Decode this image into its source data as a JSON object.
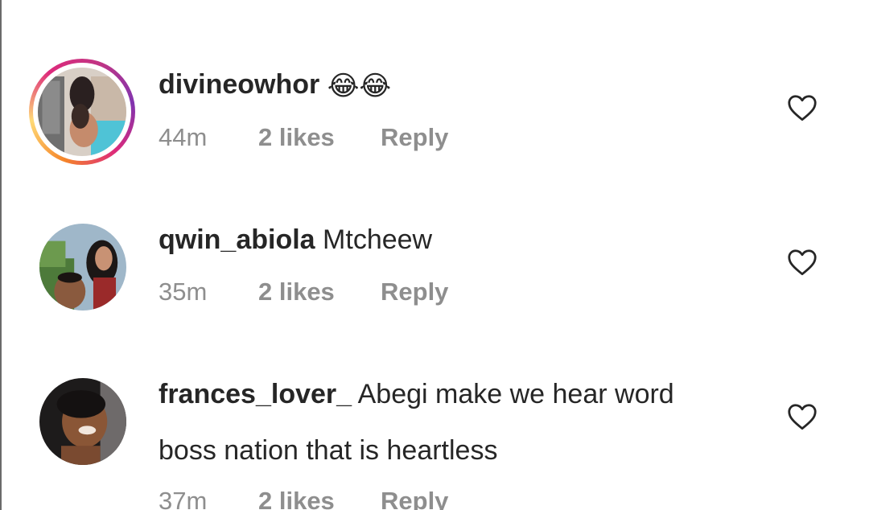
{
  "comments": [
    {
      "username": "divineowhor",
      "text": "😂😂",
      "continuation": "",
      "time": "44m",
      "likes": "2 likes",
      "reply": "Reply",
      "story_ring": true,
      "icon": "heart-outline-icon"
    },
    {
      "username": "qwin_abiola",
      "text": "Mtcheew",
      "continuation": "",
      "time": "35m",
      "likes": "2 likes",
      "reply": "Reply",
      "story_ring": false,
      "icon": "heart-outline-icon"
    },
    {
      "username": "frances_lover_",
      "text": "Abegi make we hear word",
      "continuation": "boss nation that is heartless",
      "time": "37m",
      "likes": "2 likes",
      "reply": "Reply",
      "story_ring": false,
      "icon": "heart-outline-icon"
    }
  ],
  "colors": {
    "text_primary": "#262626",
    "text_secondary": "#8e8e8e",
    "story_ring": [
      "#f58529",
      "#dd2a7b",
      "#8134af"
    ]
  }
}
